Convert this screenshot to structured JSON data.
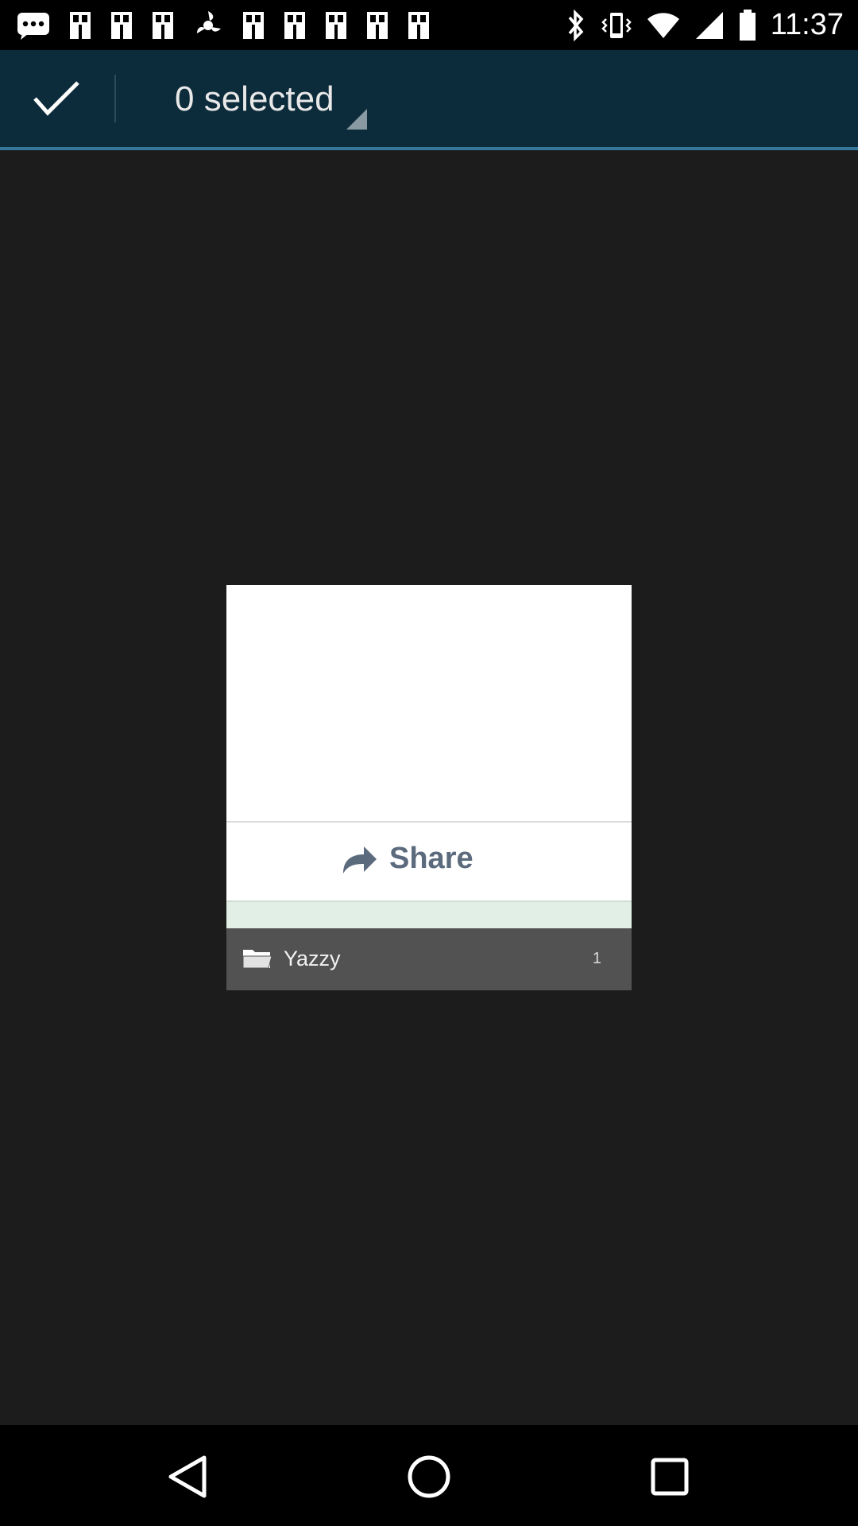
{
  "status_bar": {
    "left_icons": [
      "message-icon",
      "photo-icon",
      "photo-icon",
      "photo-icon",
      "settings-icon",
      "photo-icon",
      "photo-icon",
      "photo-icon",
      "photo-icon",
      "photo-icon"
    ],
    "right_icons": [
      "bluetooth-icon",
      "vibrate-icon",
      "wifi-icon",
      "signal-icon",
      "battery-icon"
    ],
    "time": "11:37"
  },
  "action_bar": {
    "done_icon": "checkmark-icon",
    "selection_label": "0 selected",
    "background": "#0c2b3b",
    "accent": "#36789a"
  },
  "thumbnail": {
    "share_label": "Share",
    "share_icon": "share-arrow-icon",
    "album": {
      "name": "Yazzy",
      "count": "1",
      "icon": "folder-icon"
    }
  },
  "nav_bar": {
    "buttons": [
      "back-icon",
      "home-icon",
      "recents-icon"
    ]
  }
}
